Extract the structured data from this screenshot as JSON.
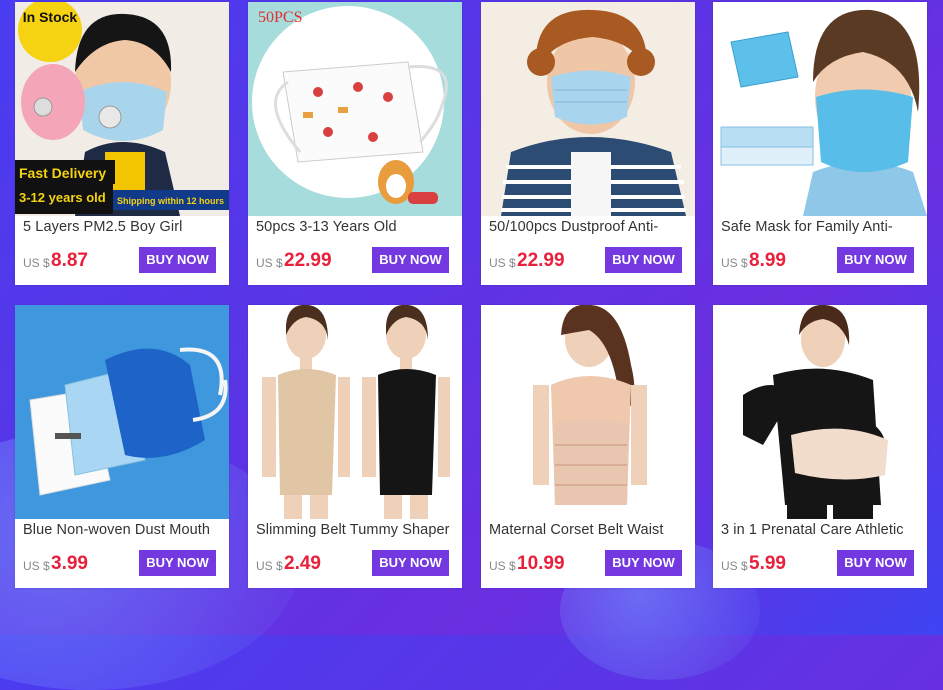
{
  "products": [
    {
      "title": "5 Layers PM2.5 Boy Girl",
      "currency": "US $",
      "price": "8.87",
      "buy": "BUY NOW",
      "badge": "In Stock",
      "banner1": "Fast Delivery",
      "banner2": "3-12 years old",
      "banner3": "Shipping within 12 hours"
    },
    {
      "title": "50pcs 3-13 Years Old",
      "currency": "US $",
      "price": "22.99",
      "buy": "BUY NOW",
      "badge": "50PCS"
    },
    {
      "title": "50/100pcs Dustproof Anti-",
      "currency": "US $",
      "price": "22.99",
      "buy": "BUY NOW"
    },
    {
      "title": "Safe Mask for Family Anti-",
      "currency": "US $",
      "price": "8.99",
      "buy": "BUY NOW"
    },
    {
      "title": "Blue Non-woven Dust Mouth",
      "currency": "US $",
      "price": "3.99",
      "buy": "BUY NOW"
    },
    {
      "title": "Slimming Belt Tummy Shaper",
      "currency": "US $",
      "price": "2.49",
      "buy": "BUY NOW"
    },
    {
      "title": "Maternal Corset Belt Waist",
      "currency": "US $",
      "price": "10.99",
      "buy": "BUY NOW"
    },
    {
      "title": "3 in 1 Prenatal Care Athletic",
      "currency": "US $",
      "price": "5.99",
      "buy": "BUY NOW"
    }
  ],
  "colors": {
    "price": "#e8203c",
    "button": "#7338e0",
    "background": "#4a3cf0"
  }
}
